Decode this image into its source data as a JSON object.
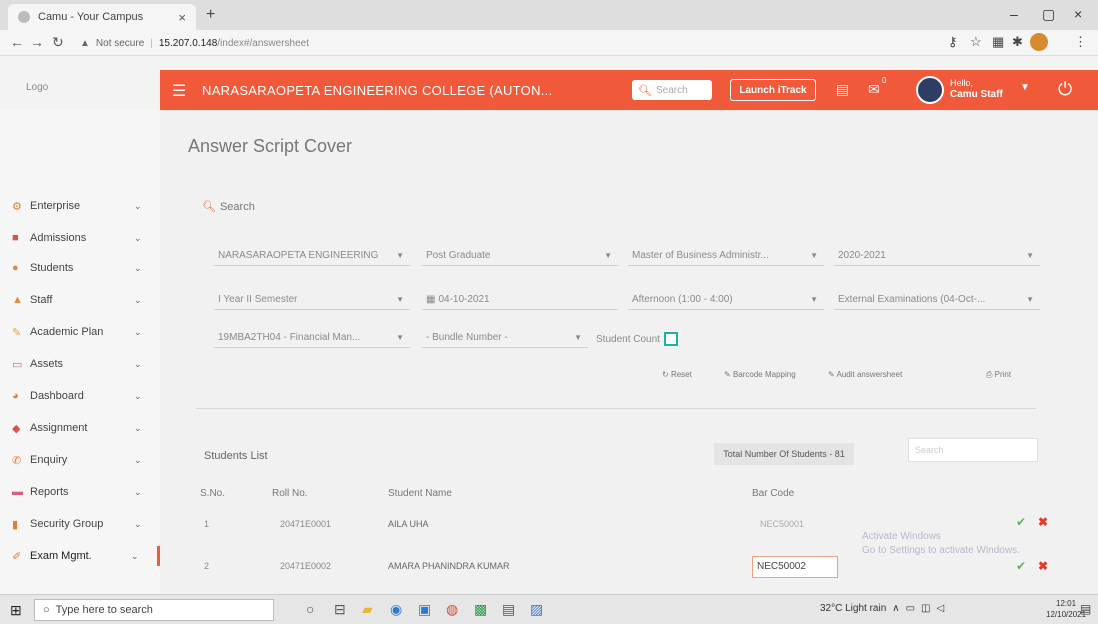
{
  "browser": {
    "tab_title": "Camu - Your Campus",
    "tab_close": "×",
    "new_tab": "+",
    "win_min": "–",
    "win_max": "▢",
    "win_close": "×",
    "not_secure": "Not secure",
    "host": "15.207.0.148",
    "path": "/index#/answersheet"
  },
  "header": {
    "logo_alt": "Logo",
    "college_name": "NARASARAOPETA ENGINEERING COLLEGE (AUTON...",
    "search_placeholder": "Search",
    "launch_button": "Launch iTrack",
    "notification_count": "0",
    "user_greeting": "Hello,",
    "user_name": "Camu Staff",
    "accent_color": "#f05a3a"
  },
  "sidebar": {
    "items": [
      {
        "label": "Enterprise",
        "icon": "enterprise-icon"
      },
      {
        "label": "Admissions",
        "icon": "admissions-icon"
      },
      {
        "label": "Students",
        "icon": "students-icon"
      },
      {
        "label": "Staff",
        "icon": "staff-icon"
      },
      {
        "label": "Academic Plan",
        "icon": "academic-plan-icon"
      },
      {
        "label": "Assets",
        "icon": "assets-icon"
      },
      {
        "label": "Dashboard",
        "icon": "dashboard-icon"
      },
      {
        "label": "Assignment",
        "icon": "assignment-icon"
      },
      {
        "label": "Enquiry",
        "icon": "enquiry-icon"
      },
      {
        "label": "Reports",
        "icon": "reports-icon"
      },
      {
        "label": "Security Group",
        "icon": "security-group-icon"
      },
      {
        "label": "Exam Mgmt.",
        "icon": "exam-mgmt-icon"
      }
    ]
  },
  "page": {
    "title": "Answer Script Cover",
    "search_label": "Search",
    "filters": {
      "institution": "NARASARAOPETA ENGINEERING",
      "program_type": "Post Graduate",
      "program": "Master of Business Administr...",
      "academic_year": "2020-2021",
      "semester": "I Year II Semester",
      "date": "04-10-2021",
      "session": "Afternoon (1:00 - 4:00)",
      "exam_type": "External Examinations (04-Oct-...",
      "subject": "19MBA2TH04 - Financial Man...",
      "bundle": "- Bundle Number -",
      "student_count_label": "Student Count"
    },
    "actions": {
      "reset": "Reset",
      "barcode_mapping": "Barcode Mapping",
      "audit": "Audit answersheet",
      "print": "Print"
    },
    "list_title": "Students List",
    "total_students": "Total Number Of Students - 81",
    "table_search_placeholder": "Search",
    "columns": [
      "S.No.",
      "Roll No.",
      "Student Name",
      "Bar Code"
    ],
    "rows": [
      {
        "sno": "1",
        "roll": "20471E0001",
        "name": "AILA UHA",
        "barcode": "NEC50001"
      },
      {
        "sno": "2",
        "roll": "20471E0002",
        "name": "AMARA PHANINDRA KUMAR",
        "barcode": "NEC50002"
      }
    ],
    "watermark_line1": "Activate Windows",
    "watermark_line2": "Go to Settings to activate Windows."
  },
  "taskbar": {
    "search_placeholder": "Type here to search",
    "weather": "32°C  Light rain",
    "time": "12:01",
    "date": "12/10/2021"
  }
}
